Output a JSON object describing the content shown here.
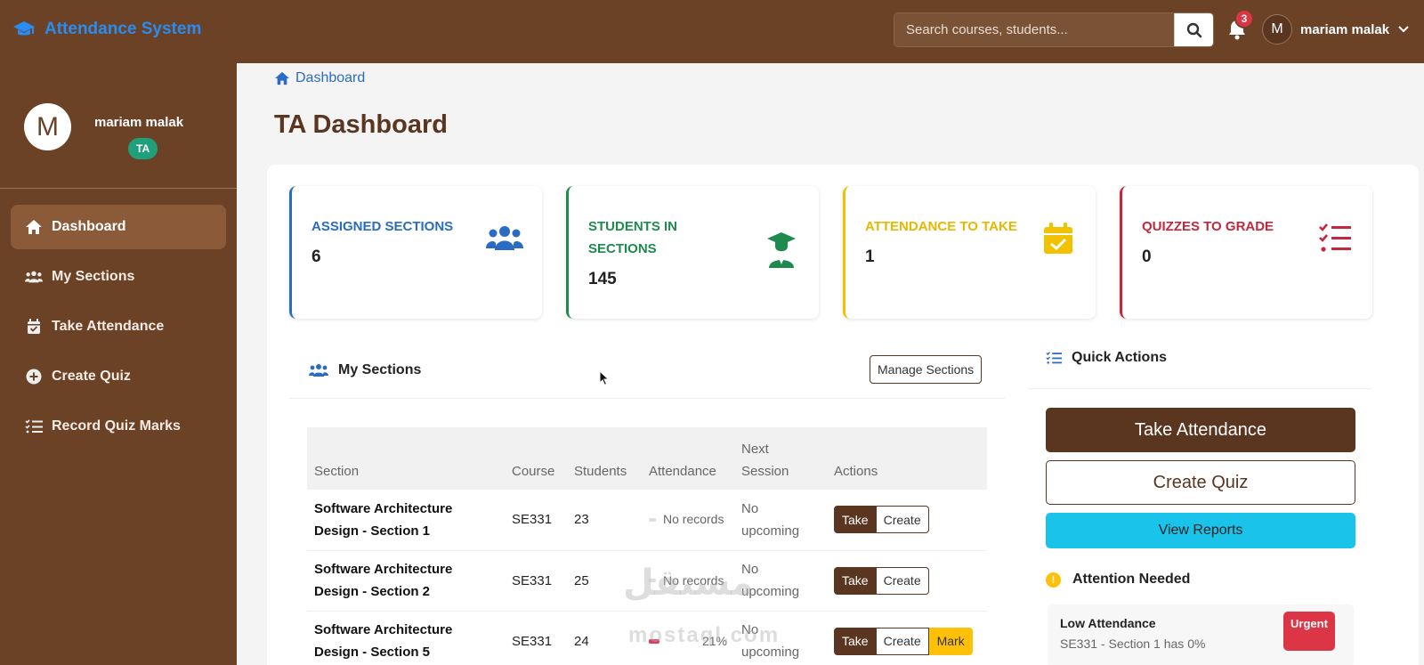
{
  "brand": {
    "title": "Attendance System"
  },
  "search": {
    "placeholder": "Search courses, students..."
  },
  "notifications": {
    "count": "3"
  },
  "user": {
    "initial": "M",
    "name": "mariam malak",
    "role": "TA"
  },
  "sidebar": {
    "items": [
      {
        "label": "Dashboard",
        "icon": "home-icon",
        "active": true
      },
      {
        "label": "My Sections",
        "icon": "users-icon"
      },
      {
        "label": "Take Attendance",
        "icon": "calendar-check-icon"
      },
      {
        "label": "Create Quiz",
        "icon": "plus-circle-icon"
      },
      {
        "label": "Record Quiz Marks",
        "icon": "list-check-icon"
      }
    ]
  },
  "breadcrumb": {
    "label": "Dashboard"
  },
  "page": {
    "title": "TA Dashboard"
  },
  "stats": [
    {
      "label": "ASSIGNED SECTIONS",
      "value": "6",
      "color": "#2a6cc4",
      "icon": "users-icon"
    },
    {
      "label": "STUDENTS IN SECTIONS",
      "value": "145",
      "color": "#1e8a4e",
      "icon": "graduate-icon"
    },
    {
      "label": "ATTENDANCE TO TAKE",
      "value": "1",
      "color": "#f2c200",
      "icon": "calendar-check-icon"
    },
    {
      "label": "QUIZZES TO GRADE",
      "value": "0",
      "color": "#c4283c",
      "icon": "list-check-icon"
    }
  ],
  "sections": {
    "title": "My Sections",
    "manage_label": "Manage Sections",
    "columns": [
      "Section",
      "Course",
      "Students",
      "Attendance",
      "Next Session",
      "Actions"
    ],
    "rows": [
      {
        "section": "Software Architecture Design - Section 1",
        "course": "SE331",
        "students": "23",
        "attendance": "No records",
        "next": "No upcoming",
        "actions": [
          "Take",
          "Create"
        ]
      },
      {
        "section": "Software Architecture Design - Section 2",
        "course": "SE331",
        "students": "25",
        "attendance": "No records",
        "next": "No upcoming",
        "actions": [
          "Take",
          "Create"
        ]
      },
      {
        "section": "Software Architecture Design - Section 5",
        "course": "SE331",
        "students": "24",
        "attendance": "21%",
        "next": "No upcoming",
        "actions": [
          "Take",
          "Create",
          "Mark"
        ]
      }
    ]
  },
  "quick_actions": {
    "title": "Quick Actions",
    "take_label": "Take Attendance",
    "create_label": "Create Quiz",
    "reports_label": "View Reports",
    "attention_title": "Attention Needed",
    "alert": {
      "title": "Low Attendance",
      "desc": "SE331 - Section 1 has 0%",
      "badge": "Urgent"
    }
  },
  "watermark": {
    "arabic": "مستقل",
    "latin": "mostaql.com"
  }
}
